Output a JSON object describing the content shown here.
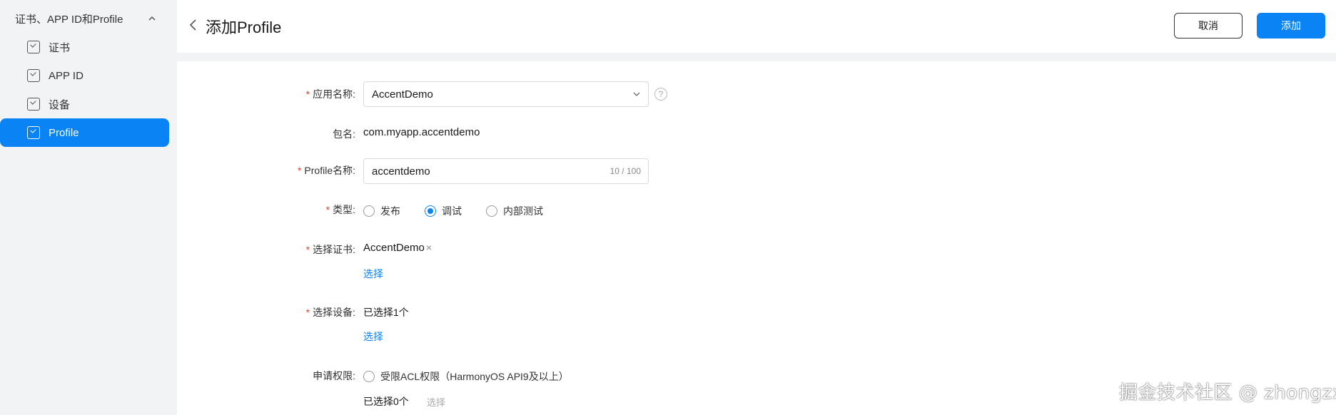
{
  "sidebar": {
    "group_label": "证书、APP ID和Profile",
    "items": [
      {
        "label": "证书"
      },
      {
        "label": "APP ID"
      },
      {
        "label": "设备"
      },
      {
        "label": "Profile"
      }
    ]
  },
  "header": {
    "title": "添加Profile",
    "cancel_label": "取消",
    "add_label": "添加"
  },
  "form": {
    "app_name": {
      "label": "应用名称:",
      "required_mark": "*",
      "value": "AccentDemo"
    },
    "package": {
      "label": "包名:",
      "value": "com.myapp.accentdemo"
    },
    "profile_name": {
      "label": "Profile名称:",
      "required_mark": "*",
      "value": "accentdemo",
      "count": "10 / 100"
    },
    "type": {
      "label": "类型:",
      "required_mark": "*",
      "options": [
        {
          "label": "发布",
          "checked": false
        },
        {
          "label": "调试",
          "checked": true
        },
        {
          "label": "内部测试",
          "checked": false
        }
      ]
    },
    "certificate": {
      "label": "选择证书:",
      "required_mark": "*",
      "tag": "AccentDemo",
      "tag_close": "×",
      "select_link": "选择"
    },
    "device": {
      "label": "选择设备:",
      "required_mark": "*",
      "selected_text": "已选择1个",
      "select_link": "选择"
    },
    "permission": {
      "label": "申请权限:",
      "option_label": "受限ACL权限（HarmonyOS API9及以上）",
      "selected_text": "已选择0个",
      "select_link": "选择"
    }
  },
  "watermark": "掘金技术社区 @ zhongzx",
  "colors": {
    "accent": "#0a84f5",
    "required": "#e84026",
    "background": "#f1f3f5"
  }
}
